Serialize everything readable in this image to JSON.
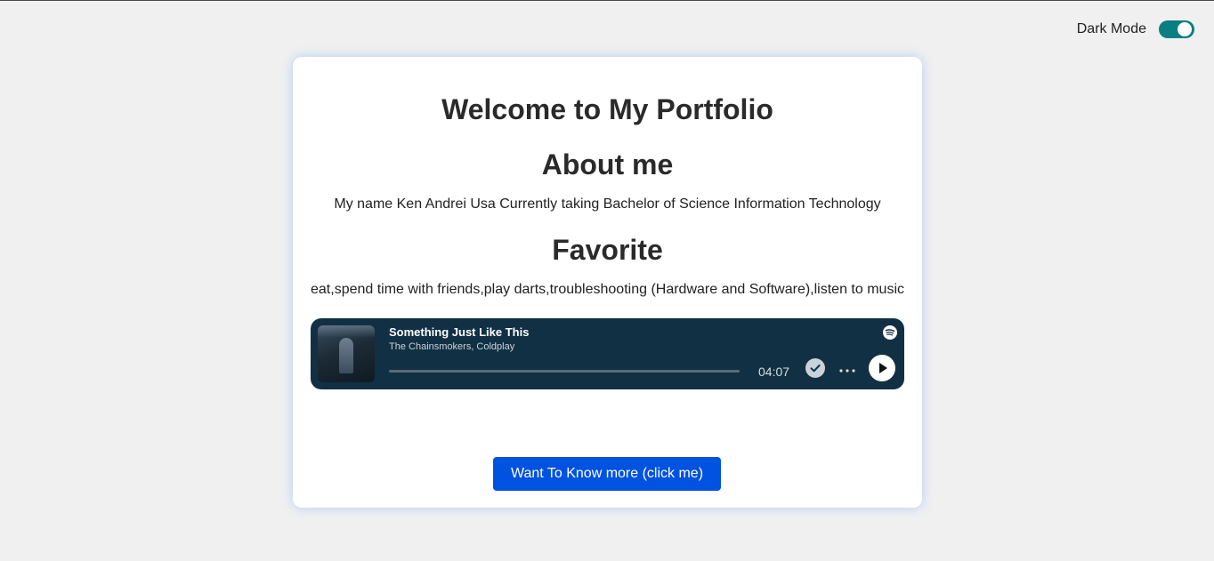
{
  "header": {
    "dark_mode_label": "Dark Mode",
    "dark_mode_enabled": true
  },
  "card": {
    "title": "Welcome to My Portfolio",
    "about": {
      "heading": "About me",
      "text": "My name Ken Andrei Usa Currently taking Bachelor of Science Information Technology"
    },
    "favorite": {
      "heading": "Favorite",
      "text": "eat,spend time with friends,play darts,troubleshooting (Hardware and Software),listen to music"
    },
    "player": {
      "track_title": "Something Just Like This",
      "artist": "The Chainsmokers, Coldplay",
      "duration": "04:07",
      "progress": 0,
      "icons": {
        "brand": "spotify-icon",
        "saved": "check-circle-icon",
        "more": "more-dots-icon",
        "play": "play-icon"
      }
    },
    "cta_label": "Want To Know more (click me)"
  },
  "colors": {
    "background": "#f0f0f0",
    "card_bg": "#ffffff",
    "toggle_on": "#0a7e80",
    "player_bg": "#123044",
    "button_bg": "#0052e0"
  }
}
